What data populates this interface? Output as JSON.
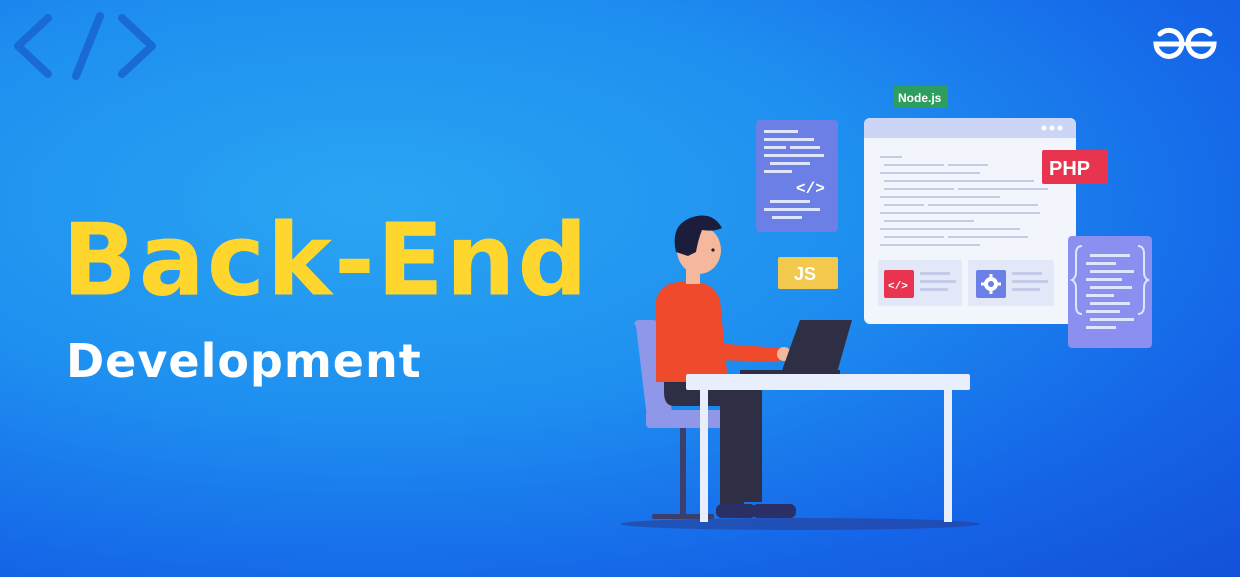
{
  "banner": {
    "title": "Back-End",
    "subtitle": "Development",
    "badges": {
      "node": "Node.js",
      "php": "PHP",
      "js": "JS"
    },
    "code_symbol": "</>",
    "icons": [
      "code-brackets-icon",
      "gfg-logo-icon",
      "gear-icon",
      "code-icon"
    ],
    "colors": {
      "background": "#1e8ff0",
      "title": "#ffd62e",
      "subtitle": "#ffffff",
      "php_badge": "#e8344e",
      "node_badge": "#2e9e5e",
      "js_badge": "#f2c94c"
    }
  }
}
